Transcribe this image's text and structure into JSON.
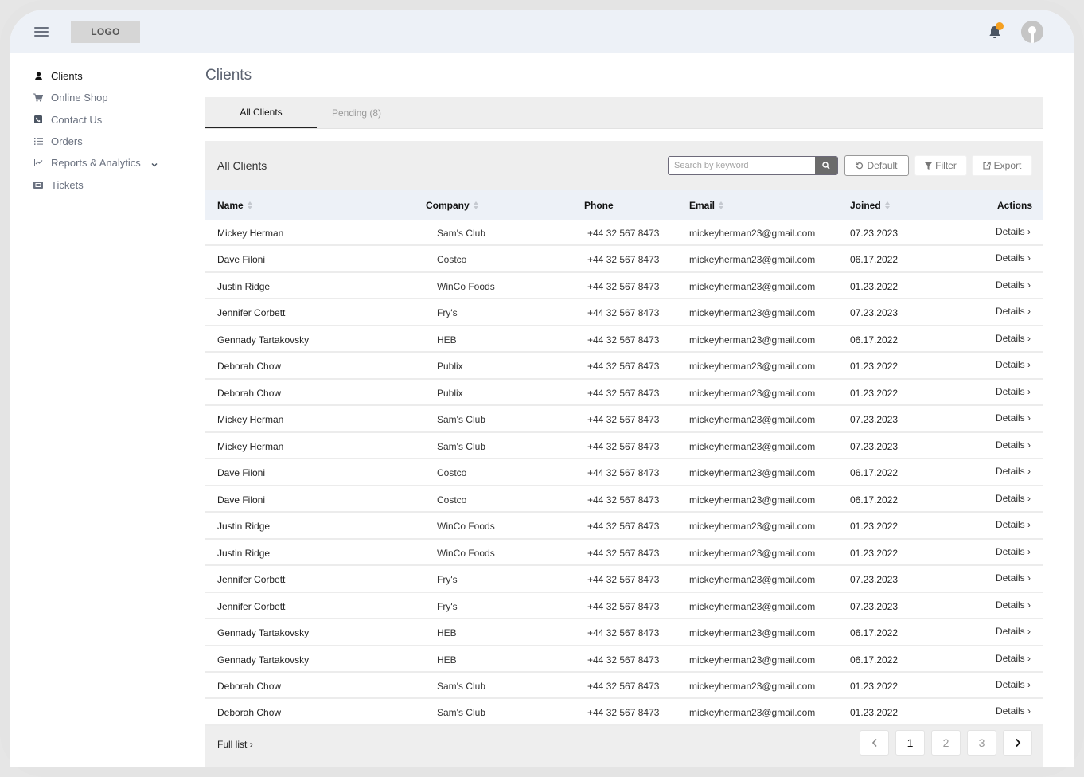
{
  "header": {
    "logo": "LOGO",
    "icons": {
      "menu": "hamburger-icon",
      "notifications": "bell-icon",
      "profile": "avatar-icon"
    },
    "notification_dot_color": "#f5a021"
  },
  "sidebar": {
    "items": [
      {
        "label": "Clients",
        "icon": "user-icon",
        "active": true
      },
      {
        "label": "Online Shop",
        "icon": "cart-icon"
      },
      {
        "label": "Contact Us",
        "icon": "phone-book-icon"
      },
      {
        "label": "Orders",
        "icon": "list-icon"
      },
      {
        "label": "Reports & Analytics",
        "icon": "chart-icon",
        "expandable": true
      },
      {
        "label": "Tickets",
        "icon": "ticket-icon"
      }
    ]
  },
  "main": {
    "title": "Clients",
    "tabs": [
      {
        "label": "All Clients",
        "active": true
      },
      {
        "label": "Pending (8)"
      }
    ],
    "panel": {
      "title": "All Clients",
      "search": {
        "placeholder": "Search by keyword",
        "value": ""
      },
      "buttons": {
        "default": "Default",
        "filter": "Filter",
        "export": "Export"
      }
    },
    "table": {
      "columns": [
        "Name",
        "Company",
        "Phone",
        "Email",
        "Joined",
        "Actions"
      ],
      "rows": [
        {
          "name": "Mickey Herman",
          "company": "Sam's Club",
          "phone": "+44 32 567 8473",
          "email": "mickeyherman23@gmail.com",
          "joined": "07.23.2023",
          "action": "Details"
        },
        {
          "name": "Dave Filoni",
          "company": "Costco",
          "phone": "+44 32 567 8473",
          "email": "mickeyherman23@gmail.com",
          "joined": "06.17.2022",
          "action": "Details"
        },
        {
          "name": "Justin Ridge",
          "company": "WinCo Foods",
          "phone": "+44 32 567 8473",
          "email": "mickeyherman23@gmail.com",
          "joined": "01.23.2022",
          "action": "Details"
        },
        {
          "name": "Jennifer Corbett",
          "company": "Fry's",
          "phone": "+44 32 567 8473",
          "email": "mickeyherman23@gmail.com",
          "joined": "07.23.2023",
          "action": "Details"
        },
        {
          "name": "Gennady Tartakovsky",
          "company": "HEB",
          "phone": "+44 32 567 8473",
          "email": "mickeyherman23@gmail.com",
          "joined": "06.17.2022",
          "action": "Details"
        },
        {
          "name": "Deborah Chow",
          "company": "Publix",
          "phone": "+44 32 567 8473",
          "email": "mickeyherman23@gmail.com",
          "joined": "01.23.2022",
          "action": "Details"
        },
        {
          "name": "Deborah Chow",
          "company": "Publix",
          "phone": "+44 32 567 8473",
          "email": "mickeyherman23@gmail.com",
          "joined": "01.23.2022",
          "action": "Details"
        },
        {
          "name": "Mickey Herman",
          "company": "Sam's Club",
          "phone": "+44 32 567 8473",
          "email": "mickeyherman23@gmail.com",
          "joined": "07.23.2023",
          "action": "Details"
        },
        {
          "name": "Mickey Herman",
          "company": "Sam's Club",
          "phone": "+44 32 567 8473",
          "email": "mickeyherman23@gmail.com",
          "joined": "07.23.2023",
          "action": "Details"
        },
        {
          "name": "Dave Filoni",
          "company": "Costco",
          "phone": "+44 32 567 8473",
          "email": "mickeyherman23@gmail.com",
          "joined": "06.17.2022",
          "action": "Details"
        },
        {
          "name": "Dave Filoni",
          "company": "Costco",
          "phone": "+44 32 567 8473",
          "email": "mickeyherman23@gmail.com",
          "joined": "06.17.2022",
          "action": "Details"
        },
        {
          "name": "Justin Ridge",
          "company": "WinCo Foods",
          "phone": "+44 32 567 8473",
          "email": "mickeyherman23@gmail.com",
          "joined": "01.23.2022",
          "action": "Details"
        },
        {
          "name": "Justin Ridge",
          "company": "WinCo Foods",
          "phone": "+44 32 567 8473",
          "email": "mickeyherman23@gmail.com",
          "joined": "01.23.2022",
          "action": "Details"
        },
        {
          "name": "Jennifer Corbett",
          "company": "Fry's",
          "phone": "+44 32 567 8473",
          "email": "mickeyherman23@gmail.com",
          "joined": "07.23.2023",
          "action": "Details"
        },
        {
          "name": "Jennifer Corbett",
          "company": "Fry's",
          "phone": "+44 32 567 8473",
          "email": "mickeyherman23@gmail.com",
          "joined": "07.23.2023",
          "action": "Details"
        },
        {
          "name": "Gennady Tartakovsky",
          "company": "HEB",
          "phone": "+44 32 567 8473",
          "email": "mickeyherman23@gmail.com",
          "joined": "06.17.2022",
          "action": "Details"
        },
        {
          "name": "Gennady Tartakovsky",
          "company": "HEB",
          "phone": "+44 32 567 8473",
          "email": "mickeyherman23@gmail.com",
          "joined": "06.17.2022",
          "action": "Details"
        },
        {
          "name": "Deborah Chow",
          "company": "Sam's Club",
          "phone": "+44 32 567 8473",
          "email": "mickeyherman23@gmail.com",
          "joined": "01.23.2022",
          "action": "Details"
        },
        {
          "name": "Deborah Chow",
          "company": "Sam's Club",
          "phone": "+44 32 567 8473",
          "email": "mickeyherman23@gmail.com",
          "joined": "01.23.2022",
          "action": "Details"
        }
      ]
    },
    "footer": {
      "full_list": "Full list",
      "pagination": {
        "pages": [
          "1",
          "2",
          "3"
        ],
        "current": "1"
      }
    }
  }
}
